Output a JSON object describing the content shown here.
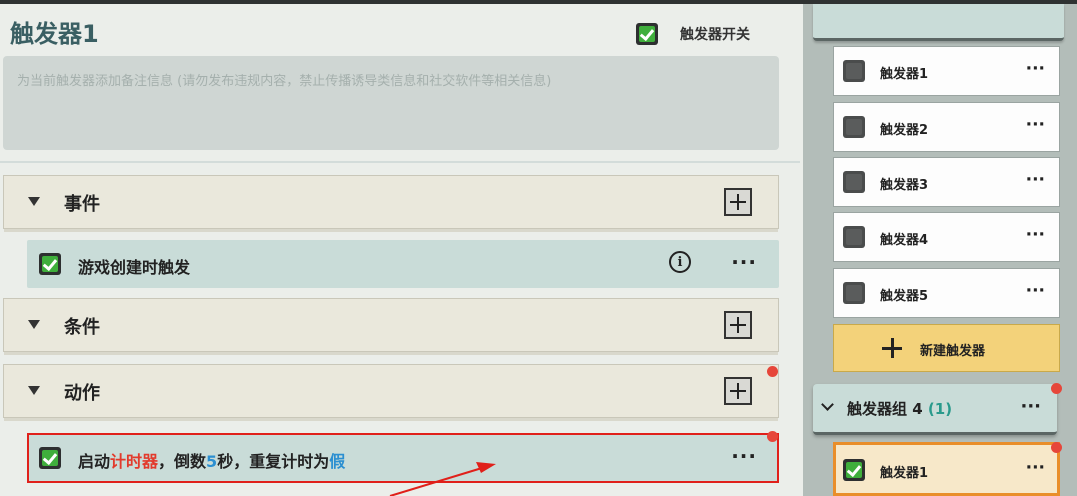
{
  "trigger": {
    "title": "触发器1",
    "switch_label": "触发器开关",
    "switch_on": true,
    "note_placeholder": "为当前触发器添加备注信息 (请勿发布违规内容，禁止传播诱导类信息和社交软件等相关信息)"
  },
  "sections": {
    "events": {
      "label": "事件",
      "items": [
        {
          "text": "游戏创建时触发",
          "checked": true
        }
      ]
    },
    "conditions": {
      "label": "条件"
    },
    "actions": {
      "label": "动作",
      "items": [
        {
          "checked": true,
          "parts": [
            "启动",
            "计时器",
            "，倒数",
            "5",
            "秒，重复计时为",
            "假"
          ]
        }
      ]
    }
  },
  "sidebar": {
    "items": [
      {
        "label": "触发器1",
        "checked": false
      },
      {
        "label": "触发器2",
        "checked": false
      },
      {
        "label": "触发器3",
        "checked": false
      },
      {
        "label": "触发器4",
        "checked": false
      },
      {
        "label": "触发器5",
        "checked": false
      }
    ],
    "new_trigger_label": "新建触发器",
    "group": {
      "label": "触发器组 4",
      "count": "(1)"
    },
    "group_items": [
      {
        "label": "触发器1",
        "checked": true
      }
    ],
    "more_glyph": "···"
  },
  "colors": {
    "highlight": "#e0201a",
    "red_text": "#e23a2c",
    "blue_text": "#2b8fd1",
    "selected_border": "#e98e2a"
  }
}
